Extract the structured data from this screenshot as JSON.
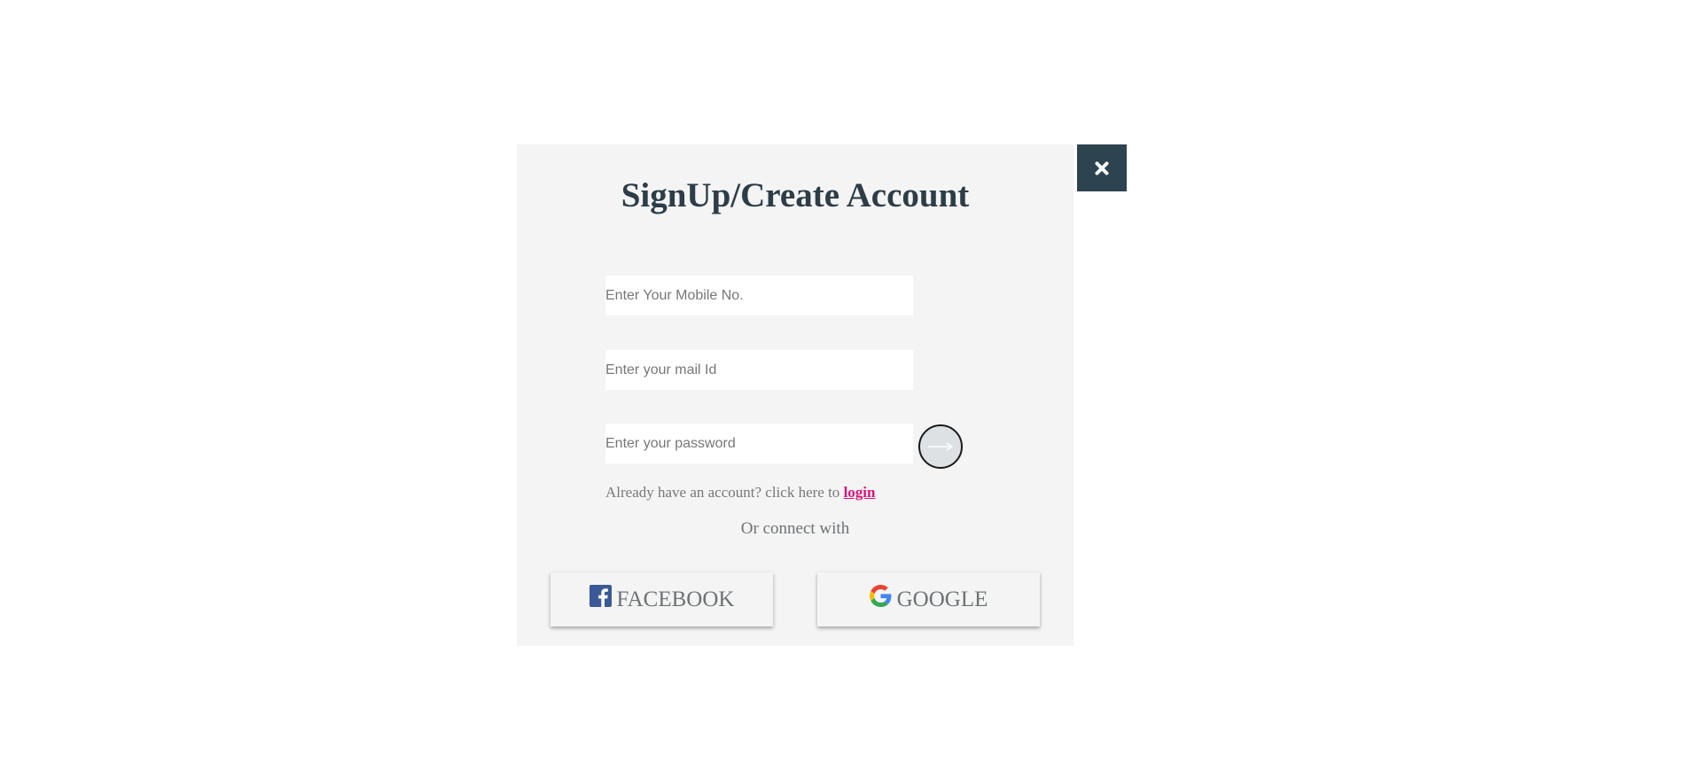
{
  "modal": {
    "title": "SignUp/Create Account",
    "close_icon": "close-icon"
  },
  "form": {
    "mobile_placeholder": "Enter Your Mobile No.",
    "email_placeholder": "Enter your mail Id",
    "password_placeholder": "Enter your password",
    "submit_icon": "arrow-right-icon"
  },
  "login_prompt": {
    "text": "Already have an account? click here to ",
    "link": "login"
  },
  "social": {
    "divider": "Or connect with",
    "facebook_label": "FACEBOOK",
    "facebook_icon": "facebook-icon",
    "google_label": "GOOGLE",
    "google_icon": "google-icon"
  },
  "colors": {
    "modal_bg": "#f4f4f4",
    "close_bg": "#2d4350",
    "title": "#2d3d48",
    "login_link": "#e0147b",
    "facebook_blue": "#3b5998"
  }
}
